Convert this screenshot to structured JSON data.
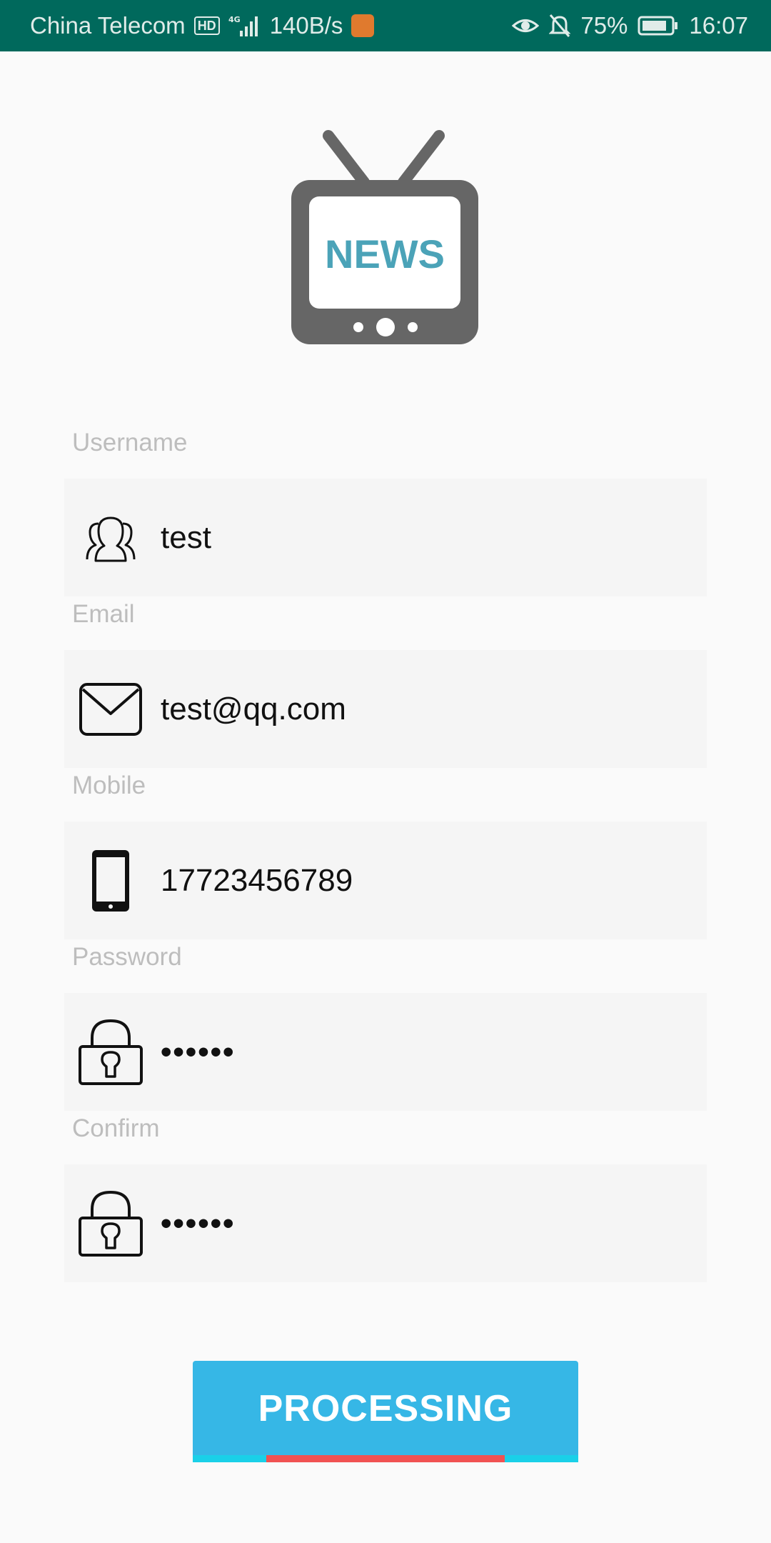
{
  "status_bar": {
    "carrier": "China Telecom",
    "hd": "HD",
    "network": "4G",
    "speed": "140B/s",
    "battery": "75%",
    "time": "16:07",
    "icons": [
      "hd-icon",
      "signal-icon",
      "uc-browser-icon",
      "eye-icon",
      "bell-off-icon",
      "battery-icon"
    ]
  },
  "logo": {
    "text": "NEWS",
    "icon": "tv-news-icon",
    "colors": {
      "frame": "#666666",
      "text": "#4ba3b8"
    }
  },
  "form": {
    "fields": [
      {
        "label": "Username",
        "value": "test",
        "icon": "users-icon"
      },
      {
        "label": "Email",
        "value": "test@qq.com",
        "icon": "envelope-icon"
      },
      {
        "label": "Mobile",
        "value": "17723456789",
        "icon": "phone-icon"
      },
      {
        "label": "Password",
        "value": "••••••",
        "icon": "lock-icon"
      },
      {
        "label": "Confirm",
        "value": "••••••",
        "icon": "lock-icon"
      }
    ]
  },
  "action": {
    "label": "PROCESSING",
    "progress": {
      "start": 0.19,
      "end": 0.81
    },
    "colors": {
      "button": "#36b7e6",
      "track": "#1ad0e8",
      "fill": "#f05252"
    }
  }
}
